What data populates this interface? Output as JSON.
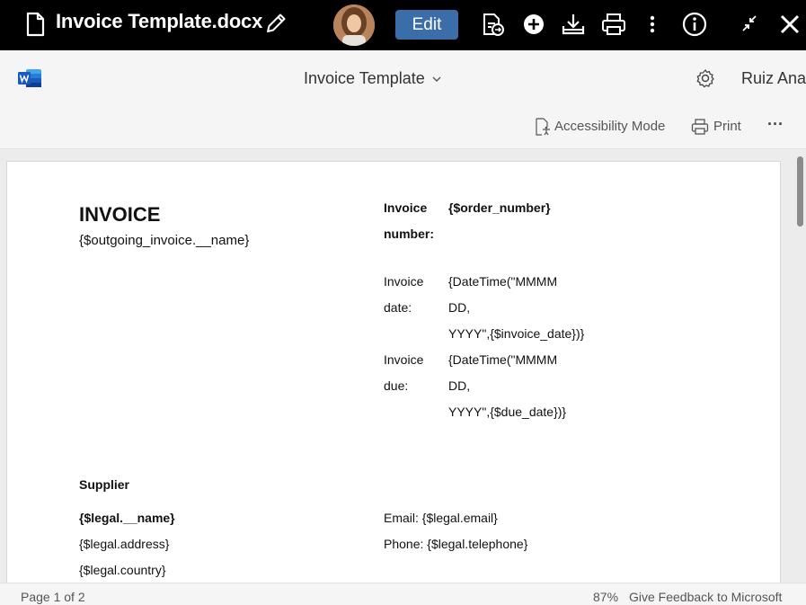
{
  "topbar": {
    "file_title": "Invoice Template.docx",
    "edit_label": "Edit"
  },
  "header": {
    "doc_title": "Invoice Template",
    "user_name": "Ruiz Ana"
  },
  "ribbon": {
    "accessibility_label": "Accessibility Mode",
    "print_label": "Print",
    "more_label": "···"
  },
  "document": {
    "heading": "INVOICE",
    "outgoing_name": "{$outgoing_invoice.__name}",
    "invoice_number_label_1": "Invoice",
    "invoice_number_label_2": "number:",
    "invoice_number_value": "{$order_number}",
    "invoice_date_label_1": "Invoice",
    "invoice_date_label_2": "date:",
    "invoice_date_value_1": "{DateTime(\"MMMM",
    "invoice_date_value_2": "DD,",
    "invoice_date_value_3": "YYYY\",{$invoice_date})}",
    "invoice_due_label_1": "Invoice",
    "invoice_due_label_2": "due:",
    "invoice_due_value_1": "{DateTime(\"MMMM",
    "invoice_due_value_2": "DD,",
    "invoice_due_value_3": "YYYY\",{$due_date})}",
    "supplier_heading": "Supplier",
    "legal_name": "{$legal.__name}",
    "legal_address": "{$legal.address}",
    "legal_country": "{$legal.country}",
    "email": "Email: {$legal.email}",
    "phone": "Phone: {$legal.telephone}"
  },
  "status": {
    "page": "Page 1 of 2",
    "zoom": "87%",
    "feedback": "Give Feedback to Microsoft"
  }
}
